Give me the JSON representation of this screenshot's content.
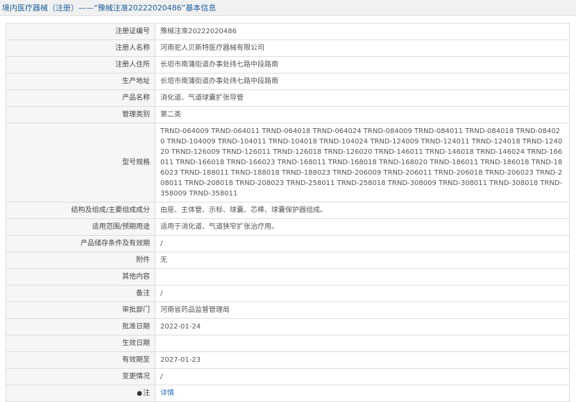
{
  "header": {
    "title": "境内医疗器械（注册）——“豫械注准20222020486”基本信息"
  },
  "rows": [
    {
      "label": "注册证编号",
      "value": "豫械注准20222020486"
    },
    {
      "label": "注册人名称",
      "value": "河南驼人贝斯特医疗器械有限公司"
    },
    {
      "label": "注册人住所",
      "value": "长垣市南蒲街道办事处纬七路中段路南"
    },
    {
      "label": "生产地址",
      "value": "长垣市南蒲街道办事处纬七路中段路南"
    },
    {
      "label": "产品名称",
      "value": "消化道、气道球囊扩张导管"
    },
    {
      "label": "管理类别",
      "value": "第二类"
    },
    {
      "label": "型号规格",
      "value": "TRND-064009 TRND-064011 TRND-064018 TRND-064024 TRND-084009 TRND-084011 TRND-084018 TRND-084020 TRND-104009 TRND-104011 TRND-104018 TRND-104024 TRND-124009 TRND-124011 TRND-124018 TRND-124020 TRND-126009 TRND-126011 TRND-126018 TRND-126020 TRND-146011 TRND-146018 TRND-146024 TRND-166011 TRND-166018 TRND-166023 TRND-168011 TRND-168018 TRND-168020 TRND-186011 TRND-186018 TRND-186023 TRND-188011 TRND-188018 TRND-188023 TRND-206009 TRND-206011 TRND-206018 TRND-206023 TRND-208011 TRND-208018 TRND-208023 TRND-258011 TRND-258018 TRND-308009 TRND-308011 TRND-308018 TRND-358009 TRND-358011"
    },
    {
      "label": "结构及组成/主要组成成分",
      "value": "由座、主体管、示标、球囊、芯棒、球囊保护器组成。"
    },
    {
      "label": "适用范围/预期用途",
      "value": "适用于消化道、气道狭窄扩张治疗用。"
    },
    {
      "label": "产品储存条件及有效期",
      "value": "/"
    },
    {
      "label": "附件",
      "value": "无"
    },
    {
      "label": "其他内容",
      "value": ""
    },
    {
      "label": "备注",
      "value": "/"
    },
    {
      "label": "审批部门",
      "value": "河南省药品监督管理局"
    },
    {
      "label": "批准日期",
      "value": "2022-01-24"
    },
    {
      "label": "生效日期",
      "value": ""
    },
    {
      "label": "有效期至",
      "value": "2027-01-23"
    },
    {
      "label": "变更情况",
      "value": "/"
    }
  ],
  "note_row": {
    "icon": "location-pin-icon",
    "label": "注",
    "link_text": "详情"
  }
}
